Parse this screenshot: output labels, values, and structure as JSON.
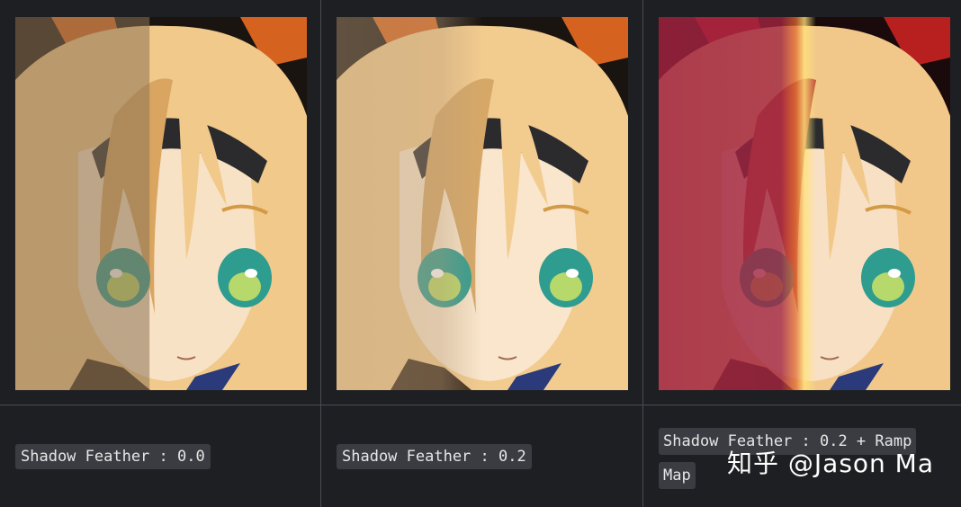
{
  "panels": [
    {
      "caption": "Shadow Feather : 0.0",
      "variant": "hard",
      "colors": {
        "hair": "#f1c98a",
        "hair_dark": "#d9a560",
        "skin": "#f8e2c6",
        "shadow": "#8c7355",
        "bow": "#d5621e",
        "bg": "#1a1410"
      }
    },
    {
      "caption": "Shadow Feather : 0.2",
      "variant": "soft",
      "colors": {
        "hair": "#f2cb8f",
        "hair_dark": "#d6a868",
        "skin": "#f9e6cc",
        "shadow": "#b99c7a",
        "bow": "#d5621e",
        "bg": "#1a1410"
      }
    },
    {
      "caption": "Shadow Feather : 0.2 + Ramp Map",
      "variant": "ramp",
      "colors": {
        "hair": "#f2c88a",
        "hair_dark": "#c0503a",
        "skin": "#f8e0c4",
        "shadow": "#a02340",
        "bow": "#b82020",
        "bg": "#1a0a0c",
        "highlight": "#ffe27a"
      }
    }
  ],
  "watermark": "知乎 @Jason Ma"
}
